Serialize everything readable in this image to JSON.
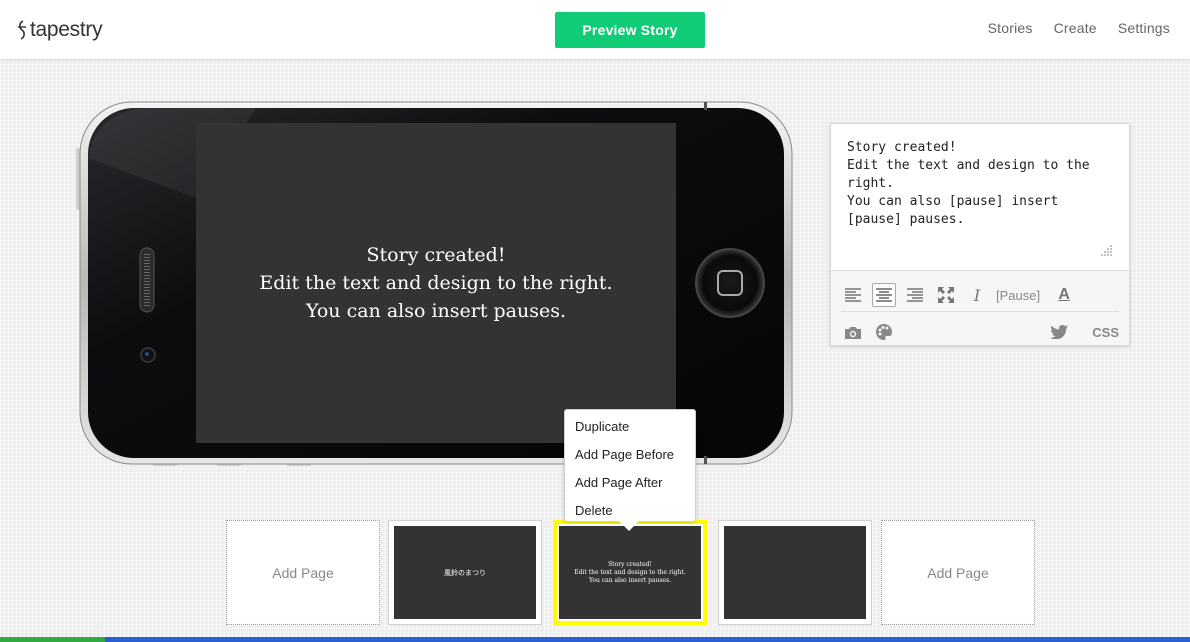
{
  "header": {
    "logo_text": "tapestry",
    "preview_label": "Preview Story",
    "nav": [
      "Stories",
      "Create",
      "Settings"
    ]
  },
  "phone": {
    "screen_lines": [
      "Story created!",
      "Edit the text and design to the right.",
      "You can also insert pauses."
    ]
  },
  "editor": {
    "text": "Story created!\nEdit the text and design to the right.\nYou can also [pause] insert [pause] pauses.",
    "pause_label": "[Pause]",
    "italic_label": "I",
    "font_color_label": "A",
    "css_label": "CSS"
  },
  "thumbnails": {
    "add_label_left": "Add Page",
    "add_label_right": "Add Page",
    "page1_text": "風鈴のまつり",
    "page2_lines": [
      "Story created!",
      "Edit the text and design to the right.",
      "You can also insert pauses."
    ]
  },
  "context_menu": {
    "items": [
      "Duplicate",
      "Add Page Before",
      "Add Page After",
      "Delete"
    ]
  },
  "colors": {
    "accent": "#11cc77",
    "selected_border": "#ffff00",
    "screen_bg": "#333333"
  }
}
